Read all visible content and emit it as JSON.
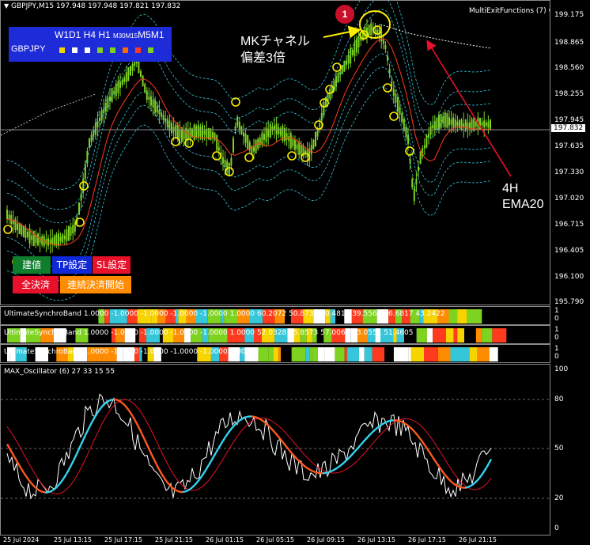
{
  "main_chart": {
    "header": "GBPJPY,M15  197.948 197.948 197.821 197.832",
    "indicator_label": "MultiExitFunctions (7)",
    "price_labels": [
      "199.175",
      "198.865",
      "198.560",
      "198.255",
      "197.945",
      "197.635",
      "197.330",
      "197.020",
      "196.715",
      "196.405",
      "196.100",
      "195.790"
    ],
    "current_price": "197.832",
    "annotation_number": "1",
    "annotation_mk": "MKチャネル",
    "annotation_dev": "偏差3倍",
    "annotation_h4": "4H",
    "annotation_ema": "EMA20",
    "tf_panel": {
      "timeframes": "W1D1 H4 H1",
      "small": "M30M15",
      "tail": "M5M1",
      "symbol": "GBPJPY",
      "squares": [
        "#f5d400",
        "#ffffff",
        "#ffffff",
        "#7ed321",
        "#7ed321",
        "#ff6a00",
        "#ff3b1f",
        "#7ed321"
      ]
    },
    "buttons": {
      "entry": "建値",
      "tp": "TP設定",
      "sl": "SL設定",
      "close_all": "全決済",
      "continuous": "連続決済開始"
    }
  },
  "subwindows": [
    {
      "title": "UltimateSynchroBand",
      "values": "1.0000 -1.0000 -1.0000 -1.0000 -1.0000 1.0000 60.2072 50.8737 60.4815 39.5563 56.6817 43.2422",
      "scale": [
        "1",
        "0"
      ]
    },
    {
      "title": "UltimateSynchroBand",
      "values": "1.0000 -1.0000 -1.0000 -1.0000 -1.0000 1.0000 52.0328 35.8573 57.0063 33.0551 51.4605",
      "scale": [
        "1",
        "0"
      ]
    },
    {
      "title": "UltimateSynchroBand",
      "values": "1.0000 -1.0000 -1.0000 -1.0000 -1.0000 1.0000",
      "scale": [
        "1",
        "0"
      ]
    }
  ],
  "oscillator": {
    "title": "MAX_Oscillator (6) 27 33 15 55",
    "scale": [
      "100",
      "80",
      "50",
      "20",
      "0"
    ]
  },
  "time_axis": [
    "25 Jul 2024",
    "25 Jul 13:15",
    "25 Jul 17:15",
    "25 Jul 21:15",
    "26 Jul 01:15",
    "26 Jul 05:15",
    "26 Jul 09:15",
    "26 Jul 13:15",
    "26 Jul 17:15",
    "26 Jul 21:15"
  ],
  "colors": {
    "candle": "#7ed321",
    "ema": "#ff3b1f",
    "band": "#35c6d9",
    "circle": "#ffee00",
    "arrow_red": "#e8102a",
    "tp_button": "#1029d8",
    "sl_button": "#e8102a",
    "entry_button": "#0e7d2c",
    "close_button": "#e8102a",
    "continuous_button": "#ff8c00",
    "osc_white": "#ffffff",
    "osc_cyan": "#35d6f0",
    "osc_orange": "#ff5a1f",
    "osc_red": "#e8102a"
  }
}
